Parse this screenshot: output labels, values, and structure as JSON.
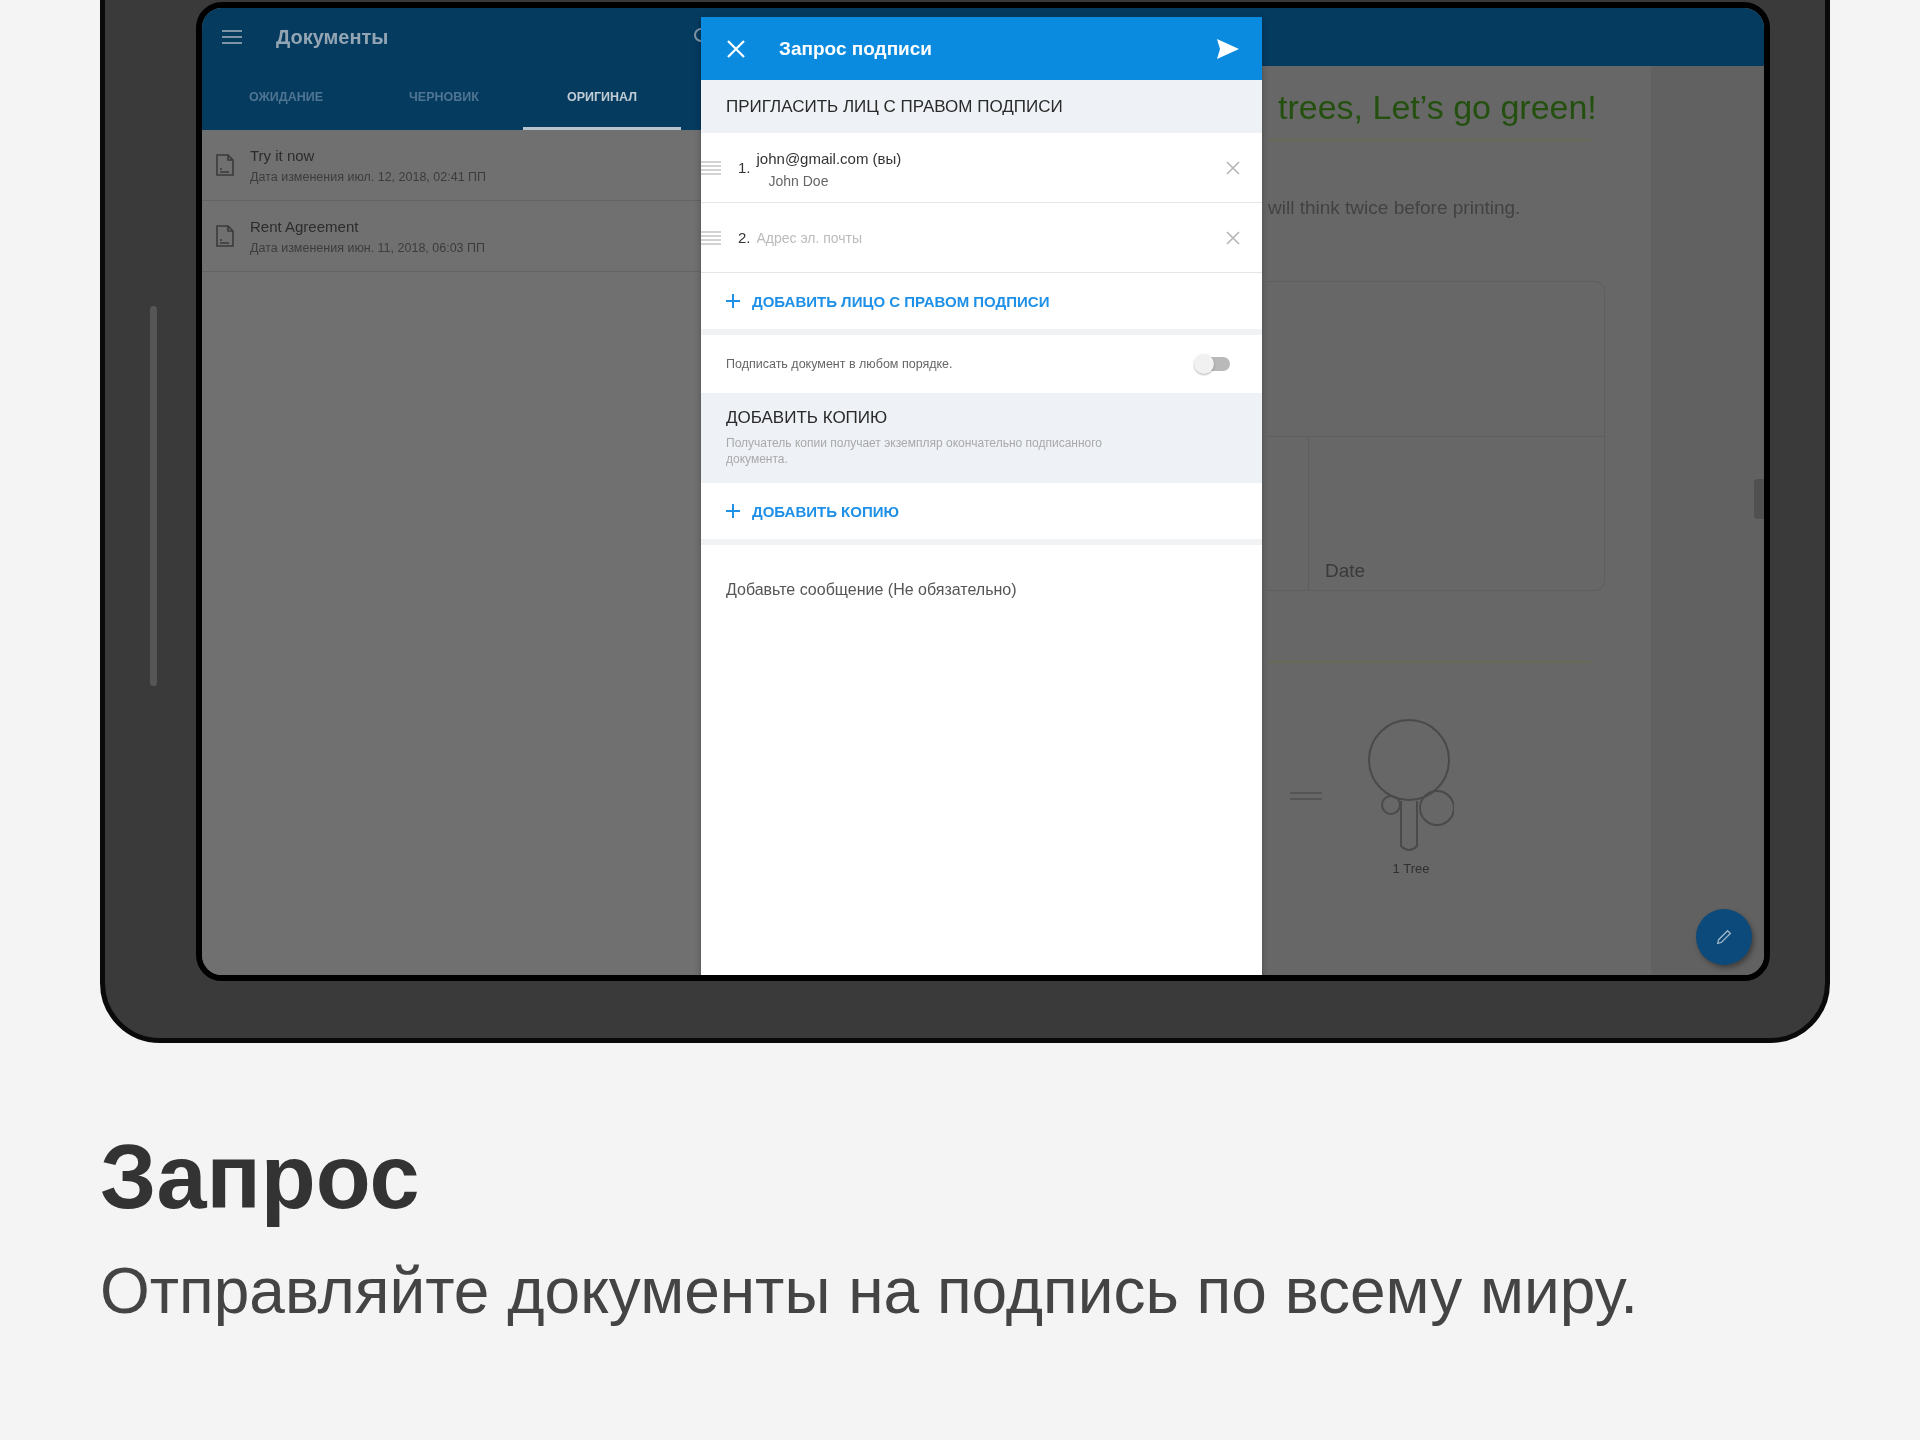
{
  "app_bar": {
    "title": "Документы"
  },
  "tabs": [
    {
      "label": "ОЖИДАНИЕ",
      "selected": false
    },
    {
      "label": "ЧЕРНОВИК",
      "selected": false
    },
    {
      "label": "ОРИГИНАЛ",
      "selected": true
    }
  ],
  "documents": [
    {
      "name": "Try it now",
      "modified": "Дата изменения июл. 12, 2018, 02:41 ПП"
    },
    {
      "name": "Rent Agreement",
      "modified": "Дата изменения июн. 11, 2018, 06:03 ПП"
    }
  ],
  "document_preview": {
    "heading": "trees, Let’s go green!",
    "text": "will think twice before printing.",
    "field_label": "Date",
    "tree_caption": "1 Tree"
  },
  "dialog": {
    "title": "Запрос подписи",
    "signers_header": "ПРИГЛАСИТЬ ЛИЦ С ПРАВОМ ПОДПИСИ",
    "signers": [
      {
        "number": "1.",
        "email": "john@gmail.com (вы)",
        "name": "John Doe"
      },
      {
        "number": "2.",
        "placeholder": "Адрес эл. почты"
      }
    ],
    "add_signer": "ДОБАВИТЬ ЛИЦО С ПРАВОМ ПОДПИСИ",
    "any_order": {
      "label": "Подписать документ в любом порядке.",
      "on": false
    },
    "copy_header": "ДОБАВИТЬ КОПИЮ",
    "copy_hint": "Получатель копии получает экземпляр окончательно подписанного документа.",
    "add_copy": "ДОБАВИТЬ КОПИЮ",
    "message": {
      "placeholder": "Добавьте сообщение (Не обязательно)"
    }
  },
  "caption": {
    "title": "Запрос",
    "subtitle": "Отправляйте документы на подпись по всему миру."
  }
}
